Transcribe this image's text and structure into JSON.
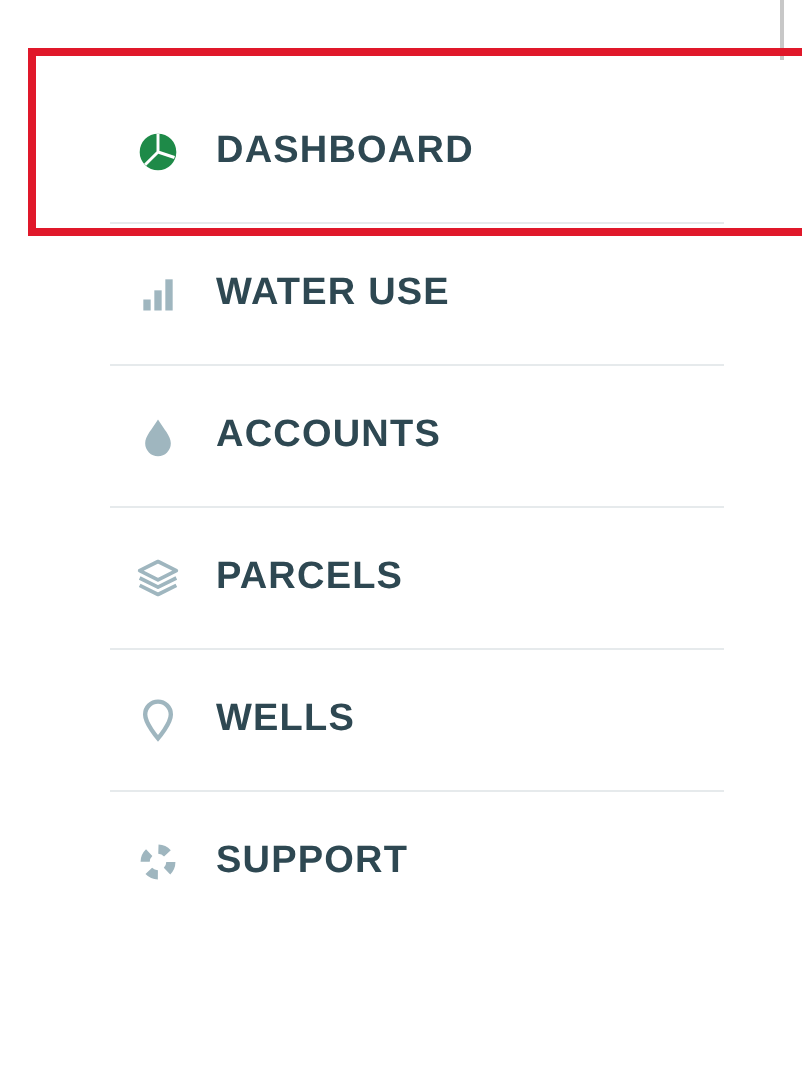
{
  "nav": {
    "items": [
      {
        "kind": "pie",
        "label": "DASHBOARD",
        "selected": true
      },
      {
        "kind": "bars",
        "label": "WATER USE",
        "selected": false
      },
      {
        "kind": "drop",
        "label": "ACCOUNTS",
        "selected": false
      },
      {
        "kind": "layers",
        "label": "PARCELS",
        "selected": false
      },
      {
        "kind": "pin",
        "label": "WELLS",
        "selected": false
      },
      {
        "kind": "buoy",
        "label": "SUPPORT",
        "selected": false
      }
    ]
  }
}
